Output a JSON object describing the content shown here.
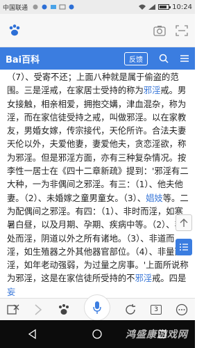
{
  "status_bar": {
    "carrier": "中国联通",
    "time": "10:24"
  },
  "search_bar": {
    "query": ""
  },
  "header": {
    "logo_text": "Bai百科",
    "feedback_label": "反馈"
  },
  "article": {
    "paragraph": [
      {
        "text": "（7）、受寄不还；上面八种就是属于偷盗的范围。三是淫戒，在家居士受持的称为"
      },
      {
        "text": "邪淫",
        "link": true
      },
      {
        "text": "戒。男女接触，相亲相爱，拥抱交媾，津血混杂，称为淫，而在家信徒受持之戒，叫做邪淫。以在家教友，男婚女嫁，传宗接代，天伦所许。合法夫妻天伦以外，夫爱他妻，妻爱他夫，贪恋淫欲，称为邪淫。但是邪淫方面，亦有三种复杂情况。按李性一居士在《四十二章新疏》提到：'邪淫有二大种，一为非偶间之邪淫。有三：（1）、他夫他妻。（2）、未婚嫁之童男童女。（3）、"
      },
      {
        "text": "娼妓",
        "link": true
      },
      {
        "text": "等。二为配偶间之邪淫。有四：（1）、非时而淫，如寒暑白昼，以及月期、孕期、疾病中等。（2）、非处而淫，阴道以外之所有诸地。（3）、非道而淫，如生殖器之外其他器官部位。（4）、非量而淫，如年老动强弱，为过量之房事。'上面所说称为邪淫，这是在家信徒所受持的不"
      },
      {
        "text": "邪淫",
        "link": true
      },
      {
        "text": "戒。四是"
      },
      {
        "text": "妄",
        "link": true
      }
    ]
  },
  "bottom_bar": {
    "tab_count": "3"
  },
  "watermark": "鸿盛康游戏网",
  "colors": {
    "accent": "#3b7de0",
    "link": "#3b78d8"
  }
}
